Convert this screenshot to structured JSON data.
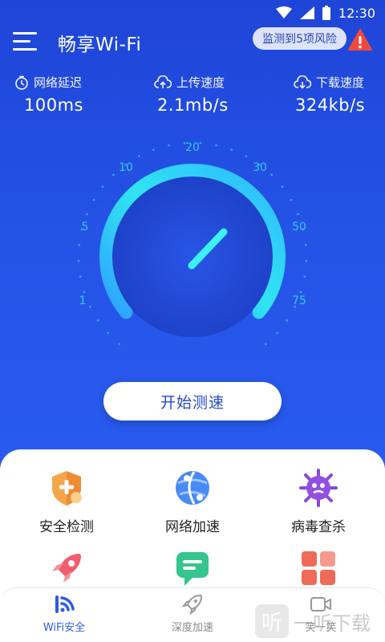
{
  "status_bar": {
    "time": "12:30"
  },
  "header": {
    "title": "畅享Wi-Fi",
    "risk_notice": "监测到5项风险"
  },
  "stats": [
    {
      "label": "网络延迟",
      "value": "100ms",
      "icon": "clock-icon"
    },
    {
      "label": "上传速度",
      "value": "2.1mb/s",
      "icon": "cloud-upload-icon"
    },
    {
      "label": "下载速度",
      "value": "324kb/s",
      "icon": "cloud-download-icon"
    }
  ],
  "gauge": {
    "scale_labels": [
      "1",
      "5",
      "10",
      "20",
      "30",
      "50",
      "75"
    ]
  },
  "start_button": "开始测速",
  "features": [
    {
      "label": "安全检测",
      "icon": "shield-plus-icon",
      "color": "#f29a3c"
    },
    {
      "label": "网络加速",
      "icon": "globe-speed-icon",
      "color": "#3d7bf0"
    },
    {
      "label": "病毒查杀",
      "icon": "virus-icon",
      "color": "#8a48d6"
    },
    {
      "label": "",
      "icon": "rocket-icon",
      "color": "#f0566a"
    },
    {
      "label": "",
      "icon": "message-icon",
      "color": "#2fc28a"
    },
    {
      "label": "",
      "icon": "apps-grid-icon",
      "color": "#f06a5a"
    }
  ],
  "tabs": [
    {
      "label": "WiFi安全",
      "icon": "wifi-icon",
      "active": true
    },
    {
      "label": "深度加速",
      "icon": "rocket-outline-icon",
      "active": false
    },
    {
      "label": "笑一笑",
      "icon": "video-icon",
      "active": false
    }
  ],
  "watermark": {
    "logo_char": "听",
    "text": "一听下载"
  },
  "colors": {
    "primary": "#2453e6",
    "accent_cyan": "#2fe0f0",
    "tab_active": "#2e5be8"
  }
}
